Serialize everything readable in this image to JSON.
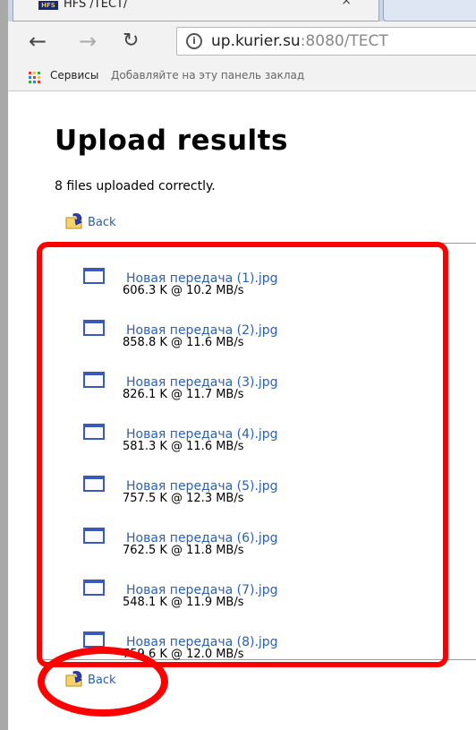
{
  "browser": {
    "tab_favicon": "HFS",
    "tab_title": "HFS /ТЕСТ/",
    "tab_close": "×",
    "url_host": "up.kurier.su",
    "url_rest": ":8080/TECT",
    "bookmarks": {
      "apps_label": "Сервисы",
      "hint": "Добавляйте на эту панель заклад"
    },
    "icons": [
      "back-arrow-icon",
      "forward-arrow-icon",
      "reload-icon",
      "info-icon",
      "apps-grid-icon"
    ]
  },
  "page": {
    "title": "Upload results",
    "summary": "8 files uploaded correctly.",
    "back_label": "Back",
    "files": [
      {
        "name": "Новая передача (1).jpg",
        "meta": "606.3 K @ 10.2 MB/s"
      },
      {
        "name": "Новая передача (2).jpg",
        "meta": "858.8 K @ 11.6 MB/s"
      },
      {
        "name": "Новая передача (3).jpg",
        "meta": "826.1 K @ 11.7 MB/s"
      },
      {
        "name": "Новая передача (4).jpg",
        "meta": "581.3 K @ 11.6 MB/s"
      },
      {
        "name": "Новая передача (5).jpg",
        "meta": "757.5 K @ 12.3 MB/s"
      },
      {
        "name": "Новая передача (6).jpg",
        "meta": "762.5 K @ 11.8 MB/s"
      },
      {
        "name": "Новая передача (7).jpg",
        "meta": "548.1 K @ 11.9 MB/s"
      },
      {
        "name": "Новая передача (8).jpg",
        "meta": "759.6 K @ 12.0 MB/s"
      }
    ]
  },
  "colors": {
    "link": "#2c5fb5",
    "annotation": "#ff0000",
    "file_icon": "#3a59b8"
  }
}
